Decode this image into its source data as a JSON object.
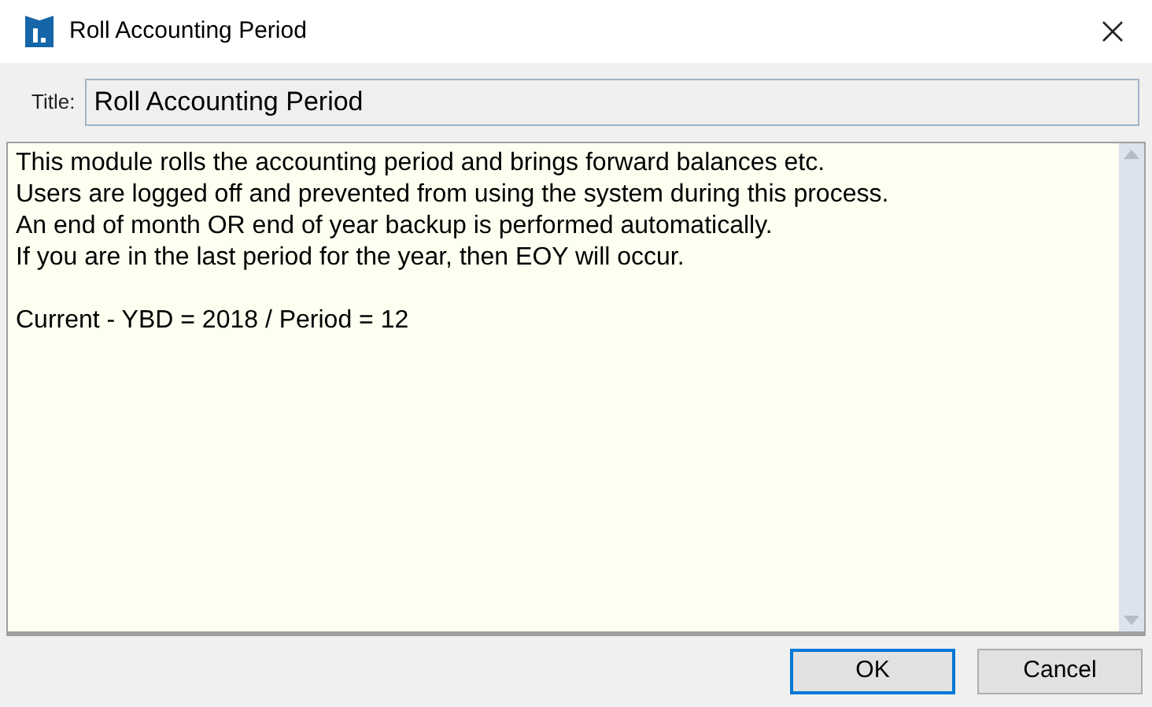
{
  "window": {
    "title": "Roll Accounting Period"
  },
  "title_field": {
    "label": "Title:",
    "value": "Roll Accounting Period"
  },
  "memo": {
    "paragraphs": [
      [
        "This module rolls the accounting period and brings forward balances etc.",
        "Users are logged off and prevented from using the system during this process.",
        "An end of month OR end of year backup is performed automatically.",
        "If you are in the last period for the year, then EOY will occur."
      ],
      [
        "Current - YBD = 2018 / Period = 12"
      ]
    ]
  },
  "buttons": [
    {
      "label": "OK",
      "default": true
    },
    {
      "label": "Cancel",
      "default": false
    }
  ]
}
